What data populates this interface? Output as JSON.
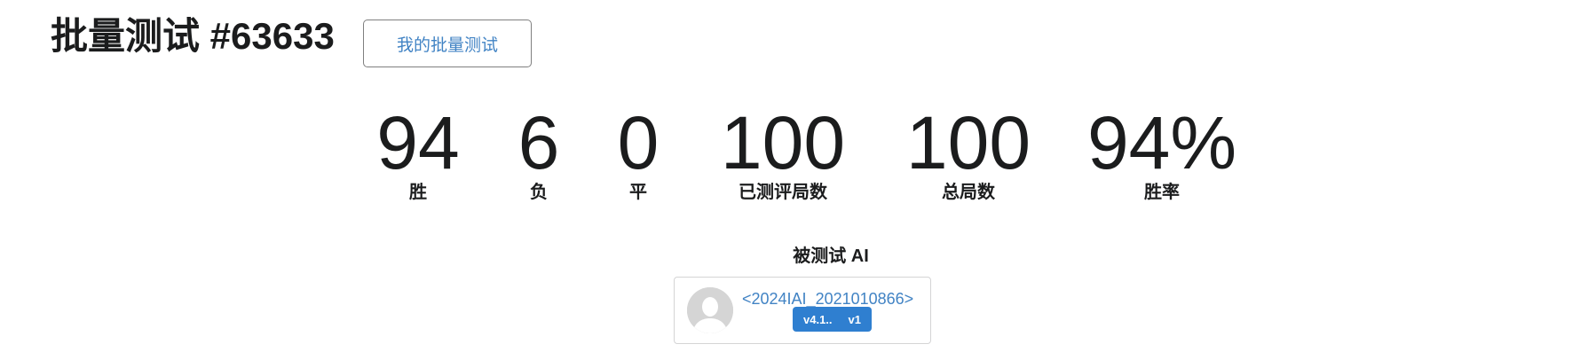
{
  "header": {
    "title": "批量测试 #63633",
    "my_batch_label": "我的批量测试"
  },
  "stats": [
    {
      "value": "94",
      "label": "胜"
    },
    {
      "value": "6",
      "label": "负"
    },
    {
      "value": "0",
      "label": "平"
    },
    {
      "value": "100",
      "label": "已测评局数"
    },
    {
      "value": "100",
      "label": "总局数"
    },
    {
      "value": "94%",
      "label": "胜率"
    }
  ],
  "tested_ai": {
    "heading": "被测试 AI",
    "name": "<2024IAI_2021010866>",
    "version": "v4.1..",
    "revision": "v1",
    "avatar_icon": "user-avatar-icon"
  },
  "colors": {
    "link": "#4183c4",
    "badge": "#2f7fd0",
    "text": "#1b1c1d"
  }
}
